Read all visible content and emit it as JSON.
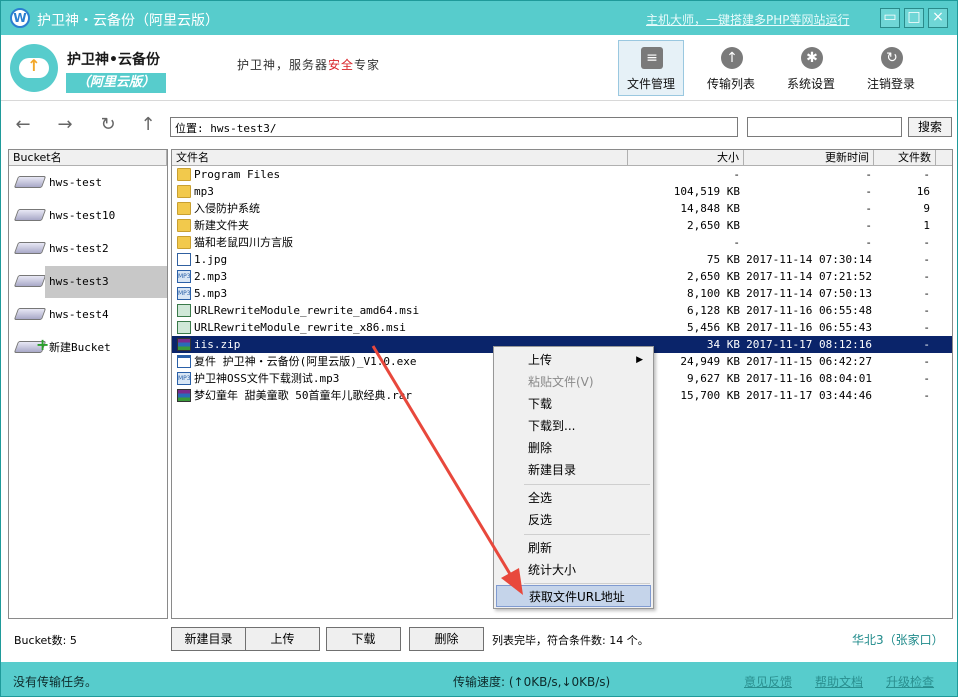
{
  "window": {
    "title": "护卫神・云备份（阿里云版）",
    "ad_link": "主机大师，一键搭建多PHP等网站运行",
    "controls": {
      "minimize": "▭",
      "maximize": "□",
      "close": "×"
    }
  },
  "header": {
    "app_name": "护卫神•云备份",
    "app_badge": "（阿里云版）",
    "slogan_prefix": "护卫神，服务器",
    "slogan_highlight": "安全",
    "slogan_suffix": "专家",
    "buttons": [
      {
        "label": "文件管理",
        "icon": "file-manager-icon"
      },
      {
        "label": "传输列表",
        "icon": "cloud-upload-icon"
      },
      {
        "label": "系统设置",
        "icon": "gear-icon"
      },
      {
        "label": "注销登录",
        "icon": "logout-icon"
      }
    ]
  },
  "nav": {
    "location": "位置: hws-test3/",
    "search_value": "",
    "search_label": "搜索"
  },
  "bucket_panel": {
    "header": "Bucket名",
    "items": [
      {
        "name": "hws-test"
      },
      {
        "name": "hws-test10"
      },
      {
        "name": "hws-test2"
      },
      {
        "name": "hws-test3"
      },
      {
        "name": "hws-test4"
      },
      {
        "name": "新建Bucket"
      }
    ],
    "selected": "hws-test3"
  },
  "file_table": {
    "columns": {
      "name": "文件名",
      "size": "大小",
      "time": "更新时间",
      "count": "文件数"
    },
    "rows": [
      {
        "type": "folder",
        "name": "Program Files",
        "size": "-",
        "time": "-",
        "count": "-"
      },
      {
        "type": "folder",
        "name": "mp3",
        "size": "104,519 KB",
        "time": "-",
        "count": "16"
      },
      {
        "type": "folder",
        "name": "入侵防护系统",
        "size": "14,848 KB",
        "time": "-",
        "count": "9"
      },
      {
        "type": "folder",
        "name": "新建文件夹",
        "size": "2,650 KB",
        "time": "-",
        "count": "1"
      },
      {
        "type": "folder",
        "name": "猫和老鼠四川方言版",
        "size": "-",
        "time": "-",
        "count": "-"
      },
      {
        "type": "file",
        "name": "1.jpg",
        "size": "75 KB",
        "time": "2017-11-14 07:30:14",
        "count": "-"
      },
      {
        "type": "mp3",
        "name": "2.mp3",
        "size": "2,650 KB",
        "time": "2017-11-14 07:21:52",
        "count": "-"
      },
      {
        "type": "mp3",
        "name": "5.mp3",
        "size": "8,100 KB",
        "time": "2017-11-14 07:50:13",
        "count": "-"
      },
      {
        "type": "msi",
        "name": "URLRewriteModule_rewrite_amd64.msi",
        "size": "6,128 KB",
        "time": "2017-11-16 06:55:48",
        "count": "-"
      },
      {
        "type": "msi",
        "name": "URLRewriteModule_rewrite_x86.msi",
        "size": "5,456 KB",
        "time": "2017-11-16 06:55:43",
        "count": "-"
      },
      {
        "type": "zip",
        "name": "iis.zip",
        "size": "34 KB",
        "time": "2017-11-17 08:12:16",
        "count": "-"
      },
      {
        "type": "exe",
        "name": "复件 护卫神・云备份(阿里云版)_V1.0.exe",
        "size": "24,949 KB",
        "time": "2017-11-15 06:42:27",
        "count": "-"
      },
      {
        "type": "mp3",
        "name": "护卫神OSS文件下载测试.mp3",
        "size": "9,627 KB",
        "time": "2017-11-16 08:04:01",
        "count": "-"
      },
      {
        "type": "zip",
        "name": "梦幻童年 甜美童歌 50首童年儿歌经典.rar",
        "size": "15,700 KB",
        "time": "2017-11-17 03:44:46",
        "count": "-"
      }
    ],
    "selected_index": 10
  },
  "context_menu": {
    "items": [
      {
        "label": "上传",
        "submenu": true
      },
      {
        "label": "粘贴文件(V)",
        "disabled": true
      },
      {
        "label": "下载"
      },
      {
        "label": "下载到..."
      },
      {
        "label": "删除"
      },
      {
        "label": "新建目录"
      },
      {
        "label": "全选"
      },
      {
        "label": "反选"
      },
      {
        "label": "刷新"
      },
      {
        "label": "统计大小"
      },
      {
        "label": "获取文件URL地址",
        "highlighted": true
      }
    ]
  },
  "bottom": {
    "bucket_count": "Bucket数: 5",
    "buttons": {
      "new_dir": "新建目录",
      "upload": "上传",
      "download": "下载",
      "delete": "删除"
    },
    "status": "列表完毕，符合条件数: 14 个。",
    "region": "华北3（张家口）"
  },
  "statusbar": {
    "tasks": "没有传输任务。",
    "speed": "传输速度: (↑0KB/s,↓0KB/s)",
    "links": {
      "feedback": "意见反馈",
      "help": "帮助文档",
      "upgrade": "升级检查"
    }
  },
  "colors": {
    "accent": "#57cccc",
    "selection": "#0a246a",
    "arrow": "#e8483c"
  }
}
